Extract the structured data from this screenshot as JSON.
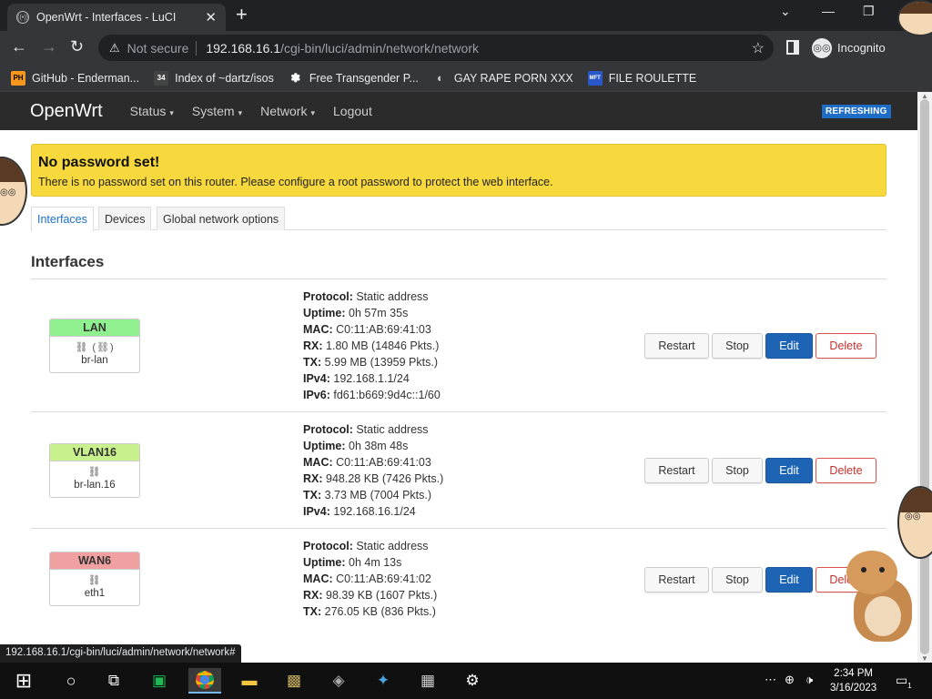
{
  "browser": {
    "tab_title": "OpenWrt - Interfaces - LuCI",
    "tab_close": "✕",
    "new_tab": "+",
    "url_security": "Not secure",
    "url_host": "192.168.16.1",
    "url_path": "/cgi-bin/luci/admin/network/network",
    "incognito_label": "Incognito",
    "bookmarks": [
      {
        "label": "GitHub - Enderman...",
        "icon_text": "PH",
        "icon_color": "#f7971d"
      },
      {
        "label": "Index of ~dartz/isos",
        "icon_text": "34",
        "icon_color": "#444444"
      },
      {
        "label": "Free Transgender P...",
        "icon_text": "✽",
        "icon_color": "#35363a"
      },
      {
        "label": "GAY RAPE PORN XXX",
        "icon_text": "◐",
        "icon_color": "#5f6368"
      },
      {
        "label": "FILE ROULETTE",
        "icon_text": "MFT",
        "icon_color": "#2a58c8"
      }
    ],
    "status_url": "192.168.16.1/cgi-bin/luci/admin/network/network#"
  },
  "luci": {
    "brand": "OpenWrt",
    "menu": [
      {
        "label": "Status",
        "has_dropdown": true
      },
      {
        "label": "System",
        "has_dropdown": true
      },
      {
        "label": "Network",
        "has_dropdown": true
      },
      {
        "label": "Logout",
        "has_dropdown": false
      }
    ],
    "menu_caret": "▾",
    "refreshing_badge": "REFRESHING",
    "alert": {
      "title": "No password set!",
      "message": "There is no password set on this router. Please configure a root password to protect the web interface."
    },
    "tabs": [
      {
        "label": "Interfaces",
        "active": true
      },
      {
        "label": "Devices",
        "active": false
      },
      {
        "label": "Global network options",
        "active": false
      }
    ],
    "section_title": "Interfaces",
    "buttons": {
      "restart": "Restart",
      "stop": "Stop",
      "edit": "Edit",
      "delete": "Delete"
    },
    "interfaces": [
      {
        "name": "LAN",
        "color": "#90f090",
        "glyph": "⛓ (⛓)",
        "device": "br-lan",
        "fields": [
          {
            "label": "Protocol:",
            "value": "Static address"
          },
          {
            "label": "Uptime:",
            "value": "0h 57m 35s"
          },
          {
            "label": "MAC:",
            "value": "C0:11:AB:69:41:03"
          },
          {
            "label": "RX:",
            "value": "1.80 MB (14846 Pkts.)"
          },
          {
            "label": "TX:",
            "value": "5.99 MB (13959 Pkts.)"
          },
          {
            "label": "IPv4:",
            "value": "192.168.1.1/24"
          },
          {
            "label": "IPv6:",
            "value": "fd61:b669:9d4c::1/60"
          }
        ]
      },
      {
        "name": "VLAN16",
        "color": "#c8f08c",
        "glyph": "⛓",
        "device": "br-lan.16",
        "fields": [
          {
            "label": "Protocol:",
            "value": "Static address"
          },
          {
            "label": "Uptime:",
            "value": "0h 38m 48s"
          },
          {
            "label": "MAC:",
            "value": "C0:11:AB:69:41:03"
          },
          {
            "label": "RX:",
            "value": "948.28 KB (7426 Pkts.)"
          },
          {
            "label": "TX:",
            "value": "3.73 MB (7004 Pkts.)"
          },
          {
            "label": "IPv4:",
            "value": "192.168.16.1/24"
          }
        ]
      },
      {
        "name": "WAN6",
        "color": "#f0a0a0",
        "glyph": "⛓",
        "device": "eth1",
        "fields": [
          {
            "label": "Protocol:",
            "value": "Static address"
          },
          {
            "label": "Uptime:",
            "value": "0h 4m 13s"
          },
          {
            "label": "MAC:",
            "value": "C0:11:AB:69:41:02"
          },
          {
            "label": "RX:",
            "value": "98.39 KB (1607 Pkts.)"
          },
          {
            "label": "TX:",
            "value": "276.05 KB (836 Pkts.)"
          }
        ]
      }
    ]
  },
  "taskbar": {
    "time": "2:34 PM",
    "date": "3/16/2023",
    "notification_count": "1"
  }
}
